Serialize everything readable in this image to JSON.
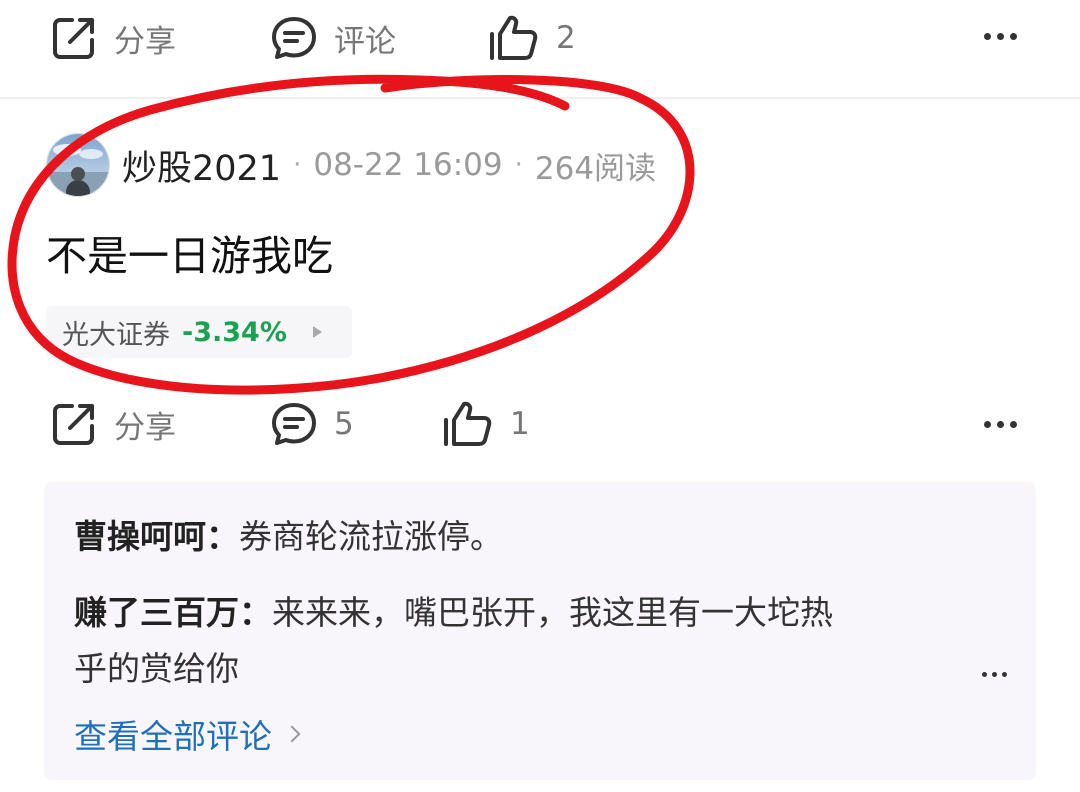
{
  "top_actions": {
    "share_label": "分享",
    "comment_label": "评论",
    "like_count": "2"
  },
  "post": {
    "author": "炒股2021",
    "date": "08-22 16:09",
    "reads": "264阅读",
    "separator": "·",
    "text": "不是一日游我吃",
    "stock_tag": {
      "name": "光大证券",
      "change": "-3.34%",
      "change_color": "#1aa251"
    }
  },
  "post_actions": {
    "share_label": "分享",
    "comment_count": "5",
    "like_count": "1"
  },
  "comments": [
    {
      "user": "曹操呵呵",
      "text": "券商轮流拉涨停。"
    },
    {
      "user": "赚了三百万",
      "text": "来来来，嘴巴张开，我这里有一大坨热",
      "text_cont": "乎的赏给你"
    }
  ],
  "comment_colon": "：",
  "view_all_label": "查看全部评论",
  "annotation": {
    "color": "#e8141c",
    "shape": "red hand-drawn ellipse"
  },
  "icons": [
    "share-icon",
    "comment-icon",
    "like-icon",
    "more-icon",
    "chevron-right-icon",
    "play-arrow-icon"
  ]
}
